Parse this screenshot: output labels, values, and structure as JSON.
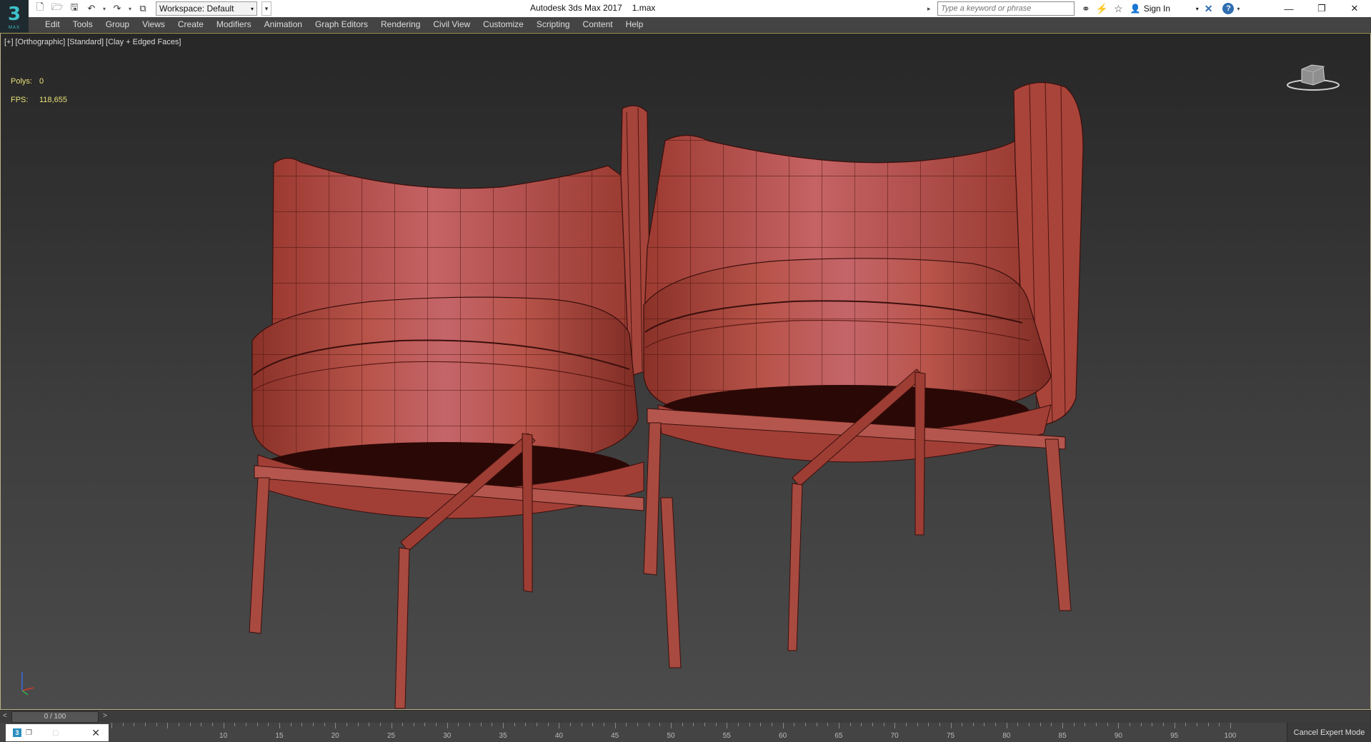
{
  "app": {
    "logo_text": "3",
    "logo_sub": "MAX",
    "title": "Autodesk 3ds Max 2017",
    "file": "1.max"
  },
  "quick_access": {
    "workspace_label": "Workspace: Default",
    "icons": [
      "new-file-icon",
      "open-file-icon",
      "save-icon",
      "undo-icon",
      "redo-icon",
      "project-folder-icon"
    ]
  },
  "search": {
    "placeholder": "Type a keyword or phrase"
  },
  "account": {
    "sign_in": "Sign In"
  },
  "menu": {
    "items": [
      "Edit",
      "Tools",
      "Group",
      "Views",
      "Create",
      "Modifiers",
      "Animation",
      "Graph Editors",
      "Rendering",
      "Civil View",
      "Customize",
      "Scripting",
      "Content",
      "Help"
    ]
  },
  "viewport": {
    "labels": [
      "[+]",
      "[Orthographic]",
      "[Standard]",
      "[Clay + Edged Faces]"
    ],
    "stats": {
      "polys_label": "Polys:",
      "polys_value": "0",
      "fps_label": "FPS:",
      "fps_value": "118,655"
    },
    "colors": {
      "mesh": "#b84a3e",
      "mesh_light": "#c9615a",
      "mesh_dark": "#7a2a22",
      "edge": "#3a0f0c",
      "stats_text": "#e8e078"
    }
  },
  "timeslider": {
    "left_arrow": "<",
    "position": "0 / 100",
    "right_arrow": ">",
    "current_frame": 0,
    "total_frames": 100
  },
  "trackbar": {
    "ticks": [
      10,
      15,
      20,
      25,
      30,
      35,
      40,
      45,
      50,
      55,
      60,
      65,
      70,
      75,
      80,
      85,
      90,
      95,
      100
    ]
  },
  "status": {
    "cancel_expert": "Cancel Expert Mode"
  }
}
